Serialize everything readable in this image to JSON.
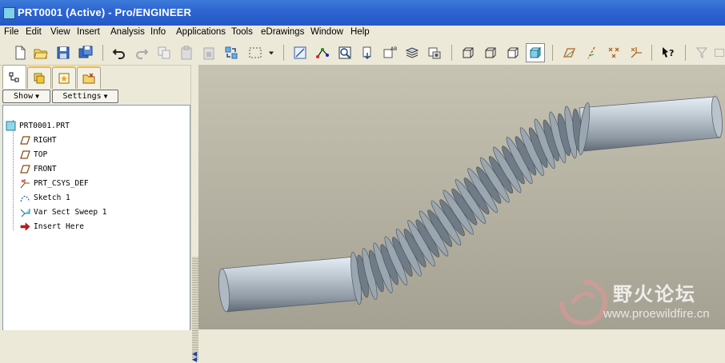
{
  "window": {
    "title": "PRT0001 (Active) - Pro/ENGINEER"
  },
  "menu": [
    "File",
    "Edit",
    "View",
    "Insert",
    "Analysis",
    "Info",
    "Applications",
    "Tools",
    "eDrawings",
    "Window",
    "Help"
  ],
  "navigator": {
    "tabs": [
      "model-tree-tab",
      "layers-tab",
      "favorites-tab",
      "folder-browser-tab"
    ],
    "show_label": "Show",
    "settings_label": "Settings",
    "tree": [
      {
        "label": "PRT0001.PRT",
        "icon": "part-icon"
      },
      {
        "label": "RIGHT",
        "icon": "datum-plane-icon"
      },
      {
        "label": "TOP",
        "icon": "datum-plane-icon"
      },
      {
        "label": "FRONT",
        "icon": "datum-plane-icon"
      },
      {
        "label": "PRT_CSYS_DEF",
        "icon": "csys-icon"
      },
      {
        "label": "Sketch 1",
        "icon": "sketch-icon"
      },
      {
        "label": "Var Sect Sweep 1",
        "icon": "sweep-icon"
      },
      {
        "label": "Insert Here",
        "icon": "insert-arrow-icon"
      }
    ]
  },
  "watermark": {
    "name": "野火论坛",
    "url": "www.proewildfire.cn"
  },
  "colors": {
    "titlebar": "#2e66d1",
    "viewport_top": "#c7c3b3",
    "viewport_bottom": "#a4a192",
    "part": "#aab4bd"
  }
}
